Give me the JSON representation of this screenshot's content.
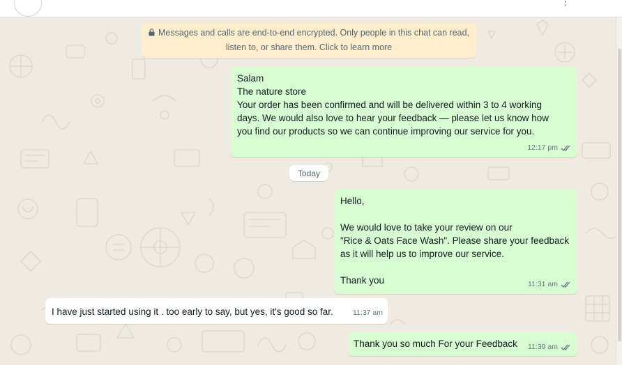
{
  "header": {
    "menu_icon": "more-vertical-icon"
  },
  "encryption_notice": {
    "icon": "lock-icon",
    "line1": "Messages and calls are end-to-end encrypted. Only people in this chat can read,",
    "line2": "listen to, or share them. Click to learn more"
  },
  "messages": [
    {
      "direction": "outgoing",
      "text": "Salam\nThe nature store\nYour order has been confirmed and will be delivered within 3 to 4 working\ndays. We would also love to hear your feedback — please let us know how\nyou find our products so we can continue improving our service for you.",
      "time": "12:17 pm",
      "status_icon": "double-check-icon"
    },
    {
      "direction": "outgoing",
      "text": "Hello,\n\nWe would love to take your review on our\n\"Rice & Oats Face Wash\". Please share your feedback\nas it will help us to improve our service.\n\nThank you",
      "time": "11:31 am",
      "status_icon": "double-check-icon"
    },
    {
      "direction": "incoming",
      "text": "I have just started using it . too early to say, but yes, it's good so far.",
      "time": "11:37 am"
    },
    {
      "direction": "outgoing",
      "text": "Thank you so much For your Feedback",
      "time": "11:39 am",
      "status_icon": "double-check-icon"
    }
  ],
  "date_separator": "Today",
  "colors": {
    "chat_background": "#efeae2",
    "outgoing_bubble": "#d9fdd3",
    "incoming_bubble": "#ffffff",
    "encryption_banner": "#ffeecd",
    "meta_text": "#667781",
    "tick_color": "#667781"
  }
}
